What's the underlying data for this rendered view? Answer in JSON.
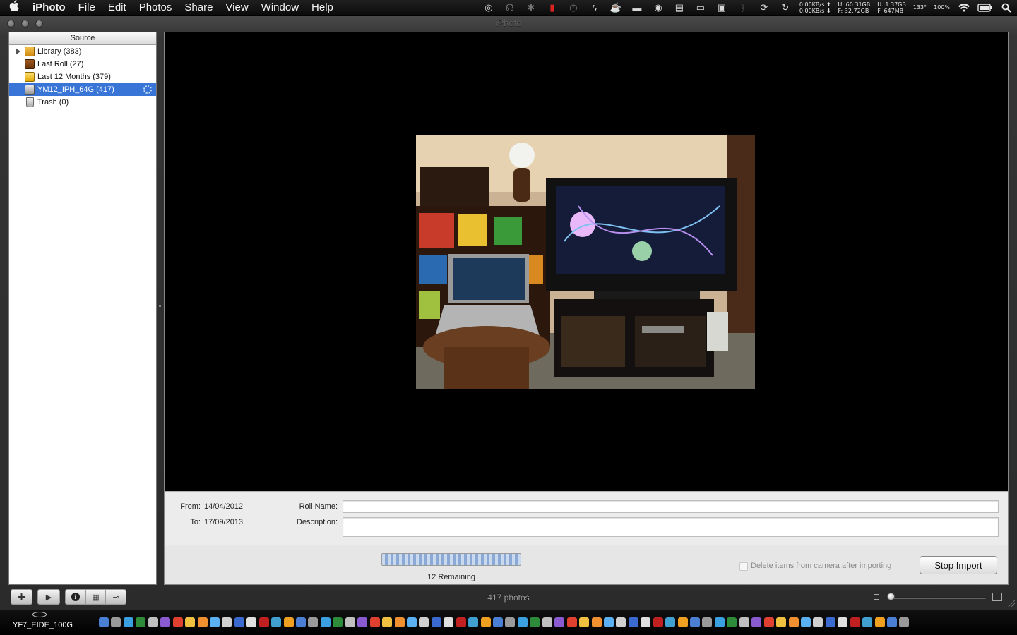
{
  "menubar": {
    "apple": "",
    "app_name": "iPhoto",
    "menus": [
      "File",
      "Edit",
      "Photos",
      "Share",
      "View",
      "Window",
      "Help"
    ],
    "status_icons": [
      {
        "name": "activity-monitor-icon",
        "glyph": "◎"
      },
      {
        "name": "headphones-icon",
        "glyph": "☊"
      },
      {
        "name": "bluetooth-icon",
        "glyph": "✱"
      },
      {
        "name": "battery-alert-icon",
        "glyph": "▮"
      },
      {
        "name": "time-machine-icon",
        "glyph": "◴"
      },
      {
        "name": "growl-icon",
        "glyph": "ϟ"
      },
      {
        "name": "cup-icon",
        "glyph": "☕"
      },
      {
        "name": "disk-icon",
        "glyph": "▬"
      },
      {
        "name": "vinyl-icon",
        "glyph": "◉"
      },
      {
        "name": "calendar-icon",
        "glyph": "▤"
      },
      {
        "name": "drive-icon",
        "glyph": "▭"
      },
      {
        "name": "display-icon",
        "glyph": "▣"
      },
      {
        "name": "bluetooth-off-icon",
        "glyph": "ᛒ"
      },
      {
        "name": "sync-icon",
        "glyph": "⟳"
      },
      {
        "name": "refresh-icon",
        "glyph": "↻"
      }
    ],
    "network": {
      "up": "0.00KB/s",
      "down": "0.00KB/s"
    },
    "disk": {
      "u_label": "U:",
      "u_value": "60.31GB",
      "f_label": "F:",
      "f_value": "32.72GB"
    },
    "memory": {
      "u_label": "U:",
      "u_value": "1.37GB",
      "f_label": "F:",
      "f_value": "647MB"
    },
    "temperature": "133°",
    "battery_pct": "100%"
  },
  "window": {
    "title": "iPhoto"
  },
  "source": {
    "header": "Source",
    "items": [
      {
        "label": "Library (383)",
        "icon": "library-icon",
        "selected": false
      },
      {
        "label": "Last Roll (27)",
        "icon": "last-roll-icon",
        "selected": false
      },
      {
        "label": "Last 12 Months (379)",
        "icon": "last-12-months-icon",
        "selected": false
      },
      {
        "label": "YM12_IPH_64G (417)",
        "icon": "camera-icon",
        "selected": true
      },
      {
        "label": "Trash (0)",
        "icon": "trash-icon",
        "selected": false
      }
    ]
  },
  "info": {
    "from_label": "From:",
    "from_value": "14/04/2012",
    "to_label": "To:",
    "to_value": "17/09/2013",
    "roll_name_label": "Roll Name:",
    "roll_name_value": "",
    "description_label": "Description:",
    "description_value": ""
  },
  "import": {
    "remaining": "12 Remaining",
    "delete_checkbox_label": "Delete items from camera after importing",
    "delete_checked": false,
    "stop_button": "Stop Import"
  },
  "toolbar": {
    "add_glyph": "+",
    "play_glyph": "▶",
    "info_glyph": "i",
    "calendar_glyph": "▦",
    "keyword_glyph": "⊸"
  },
  "status": {
    "photo_count": "417 photos"
  },
  "dock": {
    "drive_label": "YF7_EIDE_100G"
  },
  "colors": {
    "selection": "#3875d7",
    "menubar": "#111111",
    "viewer_bg": "#000000"
  }
}
